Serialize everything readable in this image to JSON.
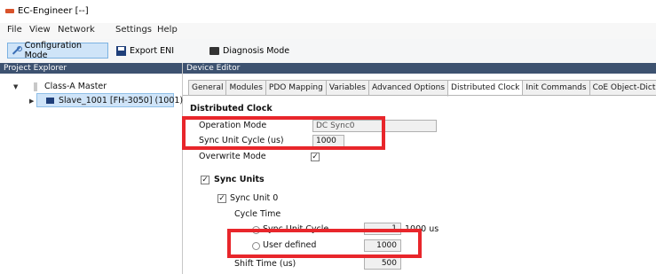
{
  "window": {
    "title": "EC-Engineer [--]"
  },
  "menu": [
    "File",
    "View",
    "Network",
    "Settings",
    "Help"
  ],
  "toolbar": {
    "configuration_mode": "Configuration Mode",
    "export_eni": "Export ENI",
    "diagnosis_mode": "Diagnosis Mode"
  },
  "project_explorer": {
    "header": "Project Explorer",
    "master": "Class-A Master",
    "slave": "Slave_1001 [FH-3050] (1001)"
  },
  "device_editor": {
    "header": "Device Editor",
    "tabs": [
      "General",
      "Modules",
      "PDO Mapping",
      "Variables",
      "Advanced Options",
      "Distributed Clock",
      "Init Commands",
      "CoE Object-Dictionary"
    ],
    "active_tab": "Distributed Clock"
  },
  "dc": {
    "section_title": "Distributed Clock",
    "operation_mode_label": "Operation Mode",
    "operation_mode_value": "DC Sync0",
    "sync_unit_cycle_label": "Sync Unit Cycle (us)",
    "sync_unit_cycle_value": "1000",
    "overwrite_mode_label": "Overwrite Mode",
    "overwrite_mode_checked": true,
    "sync_units_label": "Sync Units",
    "sync_units_checked": true,
    "sync_unit0_label": "Sync Unit 0",
    "sync_unit0_checked": true,
    "cycle_time_label": "Cycle Time",
    "sync_unit_cycle_radio_label": "Sync Unit Cycle",
    "sync_unit_cycle_radio_value": "1",
    "sync_unit_cycle_radio_suffix": "1000 us",
    "user_defined_label": "User defined",
    "user_defined_value": "1000",
    "shift_time_label": "Shift Time (us)",
    "shift_time_value": "500"
  },
  "colors": {
    "highlight": "#e8262b",
    "panel_header": "#3d5270",
    "selection": "#cfe4f8"
  }
}
